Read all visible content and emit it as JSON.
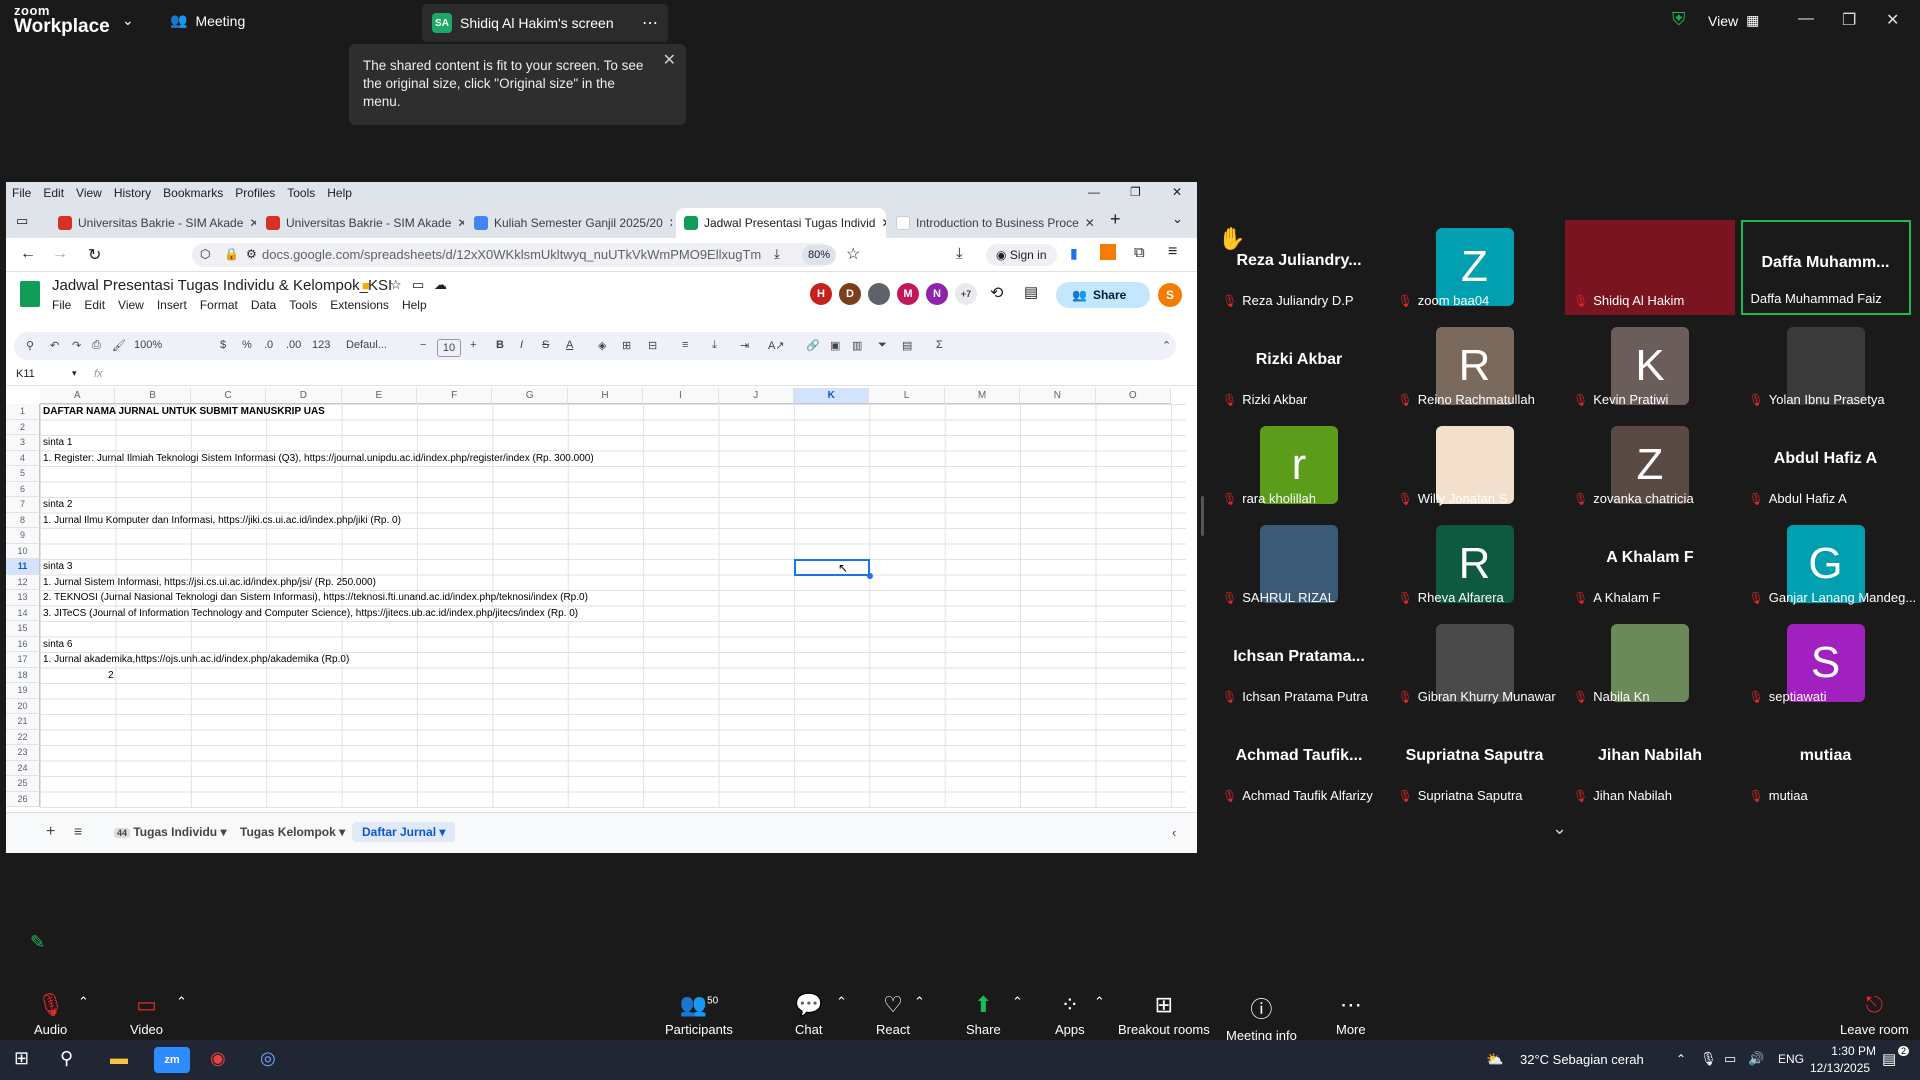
{
  "zoom": {
    "logo_line1": "zoom",
    "logo_line2": "Workplace",
    "meeting_label": "Meeting",
    "screen_badge": "SA",
    "screen_title": "Shidiq Al Hakim's screen",
    "view_label": "View",
    "tooltip": "The shared content is fit to your screen. To see the original size, click \"Original size\" in the menu."
  },
  "chrome": {
    "menu": [
      "File",
      "Edit",
      "View",
      "History",
      "Bookmarks",
      "Profiles",
      "Tools",
      "Help"
    ],
    "tabs": [
      {
        "label": "Universitas Bakrie - SIM Akade",
        "color": "#d93025"
      },
      {
        "label": "Universitas Bakrie - SIM Akade",
        "color": "#d93025"
      },
      {
        "label": "Kuliah Semester Ganjil 2025/20",
        "color": "#4285f4"
      },
      {
        "label": "Jadwal Presentasi Tugas Individ",
        "color": "#0f9d58"
      },
      {
        "label": "Introduction to Business Proce",
        "color": "#ffffff"
      }
    ],
    "url": "docs.google.com/spreadsheets/d/12xX0WKklsmUkltwyq_nuUTkVkWmPMO9EllxugTm",
    "zoom_level": "80%",
    "signin": "Sign in"
  },
  "sheets": {
    "title": "Jadwal Presentasi Tugas Individu & Kelompok_KSI",
    "menu": [
      "File",
      "Edit",
      "View",
      "Insert",
      "Format",
      "Data",
      "Tools",
      "Extensions",
      "Help"
    ],
    "avatars": [
      {
        "letter": "H",
        "color": "#c5221f"
      },
      {
        "letter": "D",
        "color": "#7b3e19"
      },
      {
        "letter": "",
        "color": "#5f6368"
      },
      {
        "letter": "M",
        "color": "#c2185b"
      },
      {
        "letter": "N",
        "color": "#8e24aa"
      }
    ],
    "more_avatars": "+7",
    "share_label": "Share",
    "user_initial": "S",
    "toolbar": {
      "zoom": "100%",
      "currency": "$",
      "percent": "%",
      "dec_less": ".0",
      "dec_more": ".00",
      "numfmt": "123",
      "font": "Defaul...",
      "fontsize": "10"
    },
    "namebox": "K11",
    "fx": "fx",
    "columns": [
      "A",
      "B",
      "C",
      "D",
      "E",
      "F",
      "G",
      "H",
      "I",
      "J",
      "K",
      "L",
      "M",
      "N",
      "O"
    ],
    "selected_col": "K",
    "rows": [
      "1",
      "2",
      "3",
      "4",
      "5",
      "6",
      "7",
      "8",
      "9",
      "10",
      "11",
      "12",
      "13",
      "14",
      "15",
      "16",
      "17",
      "18",
      "19",
      "20",
      "21",
      "22",
      "23",
      "24",
      "25",
      "26"
    ],
    "selected_row": "11",
    "cells": [
      {
        "row": 1,
        "text": "DAFTAR NAMA JURNAL UNTUK SUBMIT MANUSKRIP UAS",
        "bold": true
      },
      {
        "row": 3,
        "text": "sinta 1"
      },
      {
        "row": 4,
        "text": "1. Register: Jurnal Ilmiah Teknologi Sistem Informasi (Q3), https://journal.unipdu.ac.id/index.php/register/index (Rp. 300.000)"
      },
      {
        "row": 7,
        "text": "sinta 2"
      },
      {
        "row": 8,
        "text": "1. Jurnal Ilmu Komputer dan Informasi, https://jiki.cs.ui.ac.id/index.php/jiki (Rp. 0)"
      },
      {
        "row": 11,
        "text": "sinta 3"
      },
      {
        "row": 12,
        "text": "1. Jurnal Sistem Informasi, https://jsi.cs.ui.ac.id/index.php/jsi/ (Rp. 250.000)"
      },
      {
        "row": 13,
        "text": "2. TEKNOSI (Jurnal Nasional Teknologi dan Sistem Informasi), https://teknosi.fti.unand.ac.id/index.php/teknosi/index (Rp.0)"
      },
      {
        "row": 14,
        "text": "3. JITeCS (Journal of Information Technology and Computer Science), https://jitecs.ub.ac.id/index.php/jitecs/index (Rp. 0)"
      },
      {
        "row": 16,
        "text": "sinta 6"
      },
      {
        "row": 17,
        "text": "1. Jurnal akademika,https://ojs.unh.ac.id/index.php/akademika (Rp.0)"
      },
      {
        "row": 18,
        "text": "2",
        "indent": true
      }
    ],
    "sheet_tabs": [
      "Tugas Individu",
      "Tugas Kelompok",
      "Daftar Jurnal"
    ],
    "tab_badge": "44",
    "active_sheet": "Daftar Jurnal"
  },
  "participants": [
    {
      "name": "Reza Juliandry D.P",
      "big": "Reza Juliandry...",
      "hand": true
    },
    {
      "name": "zoom baa04",
      "avatar": "Z",
      "color": "#00a0b0"
    },
    {
      "name": "Shidiq Al Hakim",
      "video": true,
      "color": "#7a1420"
    },
    {
      "name": "Daffa Muhammad Faiz",
      "big": "Daffa Muhamm...",
      "active": true
    },
    {
      "name": "Rizki Akbar",
      "big": "Rizki Akbar"
    },
    {
      "name": "Reino Rachmatullah",
      "avatar": "R",
      "color": "#7a6a5e"
    },
    {
      "name": "Kevin Pratiwi",
      "avatar": "K",
      "color": "#6b5e5a"
    },
    {
      "name": "Yolan Ibnu Prasetya",
      "video": true,
      "color": "#3a3a3a"
    },
    {
      "name": "rara kholillah",
      "avatar": "r",
      "color": "#5b9c1a"
    },
    {
      "name": "Willy Jonatan S",
      "video": true,
      "color": "#f2e0cc"
    },
    {
      "name": "zovanka chatricia",
      "avatar": "Z",
      "color": "#5a4a44"
    },
    {
      "name": "Abdul Hafiz A",
      "big": "Abdul Hafiz A"
    },
    {
      "name": "SAHRUL RIZAL",
      "video": true,
      "color": "#3b5a78"
    },
    {
      "name": "Rheva Alfarera",
      "avatar": "R",
      "color": "#0d5a40"
    },
    {
      "name": "A Khalam F",
      "big": "A Khalam F"
    },
    {
      "name": "Ganjar Lanang Mandeg...",
      "avatar": "G",
      "color": "#00a0b0"
    },
    {
      "name": "Ichsan Pratama Putra",
      "big": "Ichsan Pratama..."
    },
    {
      "name": "Gibran Khurry Munawar",
      "video": true,
      "color": "#4a4a4a"
    },
    {
      "name": "Nabila Kn",
      "video": true,
      "color": "#6b8a5a"
    },
    {
      "name": "septiawati",
      "avatar": "S",
      "color": "#a020c0"
    },
    {
      "name": "Achmad Taufik Alfarizy",
      "big": "Achmad Taufik..."
    },
    {
      "name": "Supriatna Saputra",
      "big": "Supriatna Saputra"
    },
    {
      "name": "Jihan Nabilah",
      "big": "Jihan Nabilah"
    },
    {
      "name": "mutiaa",
      "big": "mutiaa"
    }
  ],
  "bottom_bar": {
    "audio": "Audio",
    "video": "Video",
    "participants": "Participants",
    "participants_count": "50",
    "chat": "Chat",
    "react": "React",
    "share": "Share",
    "apps": "Apps",
    "breakout": "Breakout rooms",
    "info": "Meeting info",
    "more": "More",
    "leave": "Leave room"
  },
  "taskbar": {
    "weather": "32°C Sebagian cerah",
    "lang": "ENG",
    "time": "1:30 PM",
    "date": "12/13/2025",
    "notif_count": "2"
  }
}
